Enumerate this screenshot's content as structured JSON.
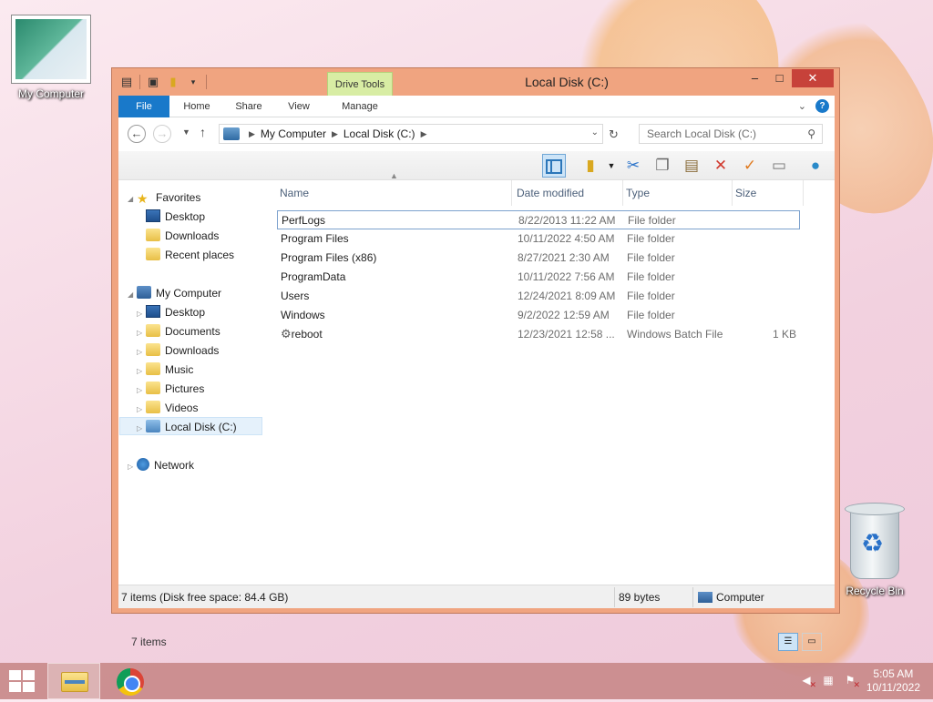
{
  "desktop": {
    "icons": [
      {
        "label": "My Computer"
      },
      {
        "label": "Recycle Bin"
      }
    ]
  },
  "window": {
    "title": "Local Disk (C:)",
    "contextual_tab_group": "Drive Tools",
    "controls": {
      "minimize": "–",
      "maximize": "□",
      "close": "✕"
    },
    "ribbon_tabs": [
      "File",
      "Home",
      "Share",
      "View",
      "Manage"
    ]
  },
  "address_bar": {
    "path": [
      "My Computer",
      "Local Disk (C:)"
    ],
    "search_placeholder": "Search Local Disk (C:)"
  },
  "nav_pane": {
    "favorites_label": "Favorites",
    "favorites": [
      "Desktop",
      "Downloads",
      "Recent places"
    ],
    "computer_label": "My Computer",
    "computer_items": [
      "Desktop",
      "Documents",
      "Downloads",
      "Music",
      "Pictures",
      "Videos",
      "Local Disk (C:)"
    ],
    "network_label": "Network"
  },
  "file_list": {
    "columns": [
      "Name",
      "Date modified",
      "Type",
      "Size"
    ],
    "rows": [
      {
        "name": "PerfLogs",
        "date": "8/22/2013 11:22 AM",
        "type": "File folder",
        "size": "",
        "icon": "folder-icon"
      },
      {
        "name": "Program Files",
        "date": "10/11/2022 4:50 AM",
        "type": "File folder",
        "size": "",
        "icon": "folder-icon"
      },
      {
        "name": "Program Files (x86)",
        "date": "8/27/2021 2:30 AM",
        "type": "File folder",
        "size": "",
        "icon": "folder-icon"
      },
      {
        "name": "ProgramData",
        "date": "10/11/2022 7:56 AM",
        "type": "File folder",
        "size": "",
        "icon": "folder-icon"
      },
      {
        "name": "Users",
        "date": "12/24/2021 8:09 AM",
        "type": "File folder",
        "size": "",
        "icon": "folder-icon"
      },
      {
        "name": "Windows",
        "date": "9/2/2022 12:59 AM",
        "type": "File folder",
        "size": "",
        "icon": "folder-icon"
      },
      {
        "name": "reboot",
        "date": "12/23/2021 12:58 ...",
        "type": "Windows Batch File",
        "size": "1 KB",
        "icon": "batch-file-icon"
      }
    ]
  },
  "footer": {
    "item_count": "7 items"
  },
  "status_bar": {
    "summary": "7 items (Disk free space: 84.4 GB)",
    "size": "89 bytes",
    "location": "Computer"
  },
  "taskbar": {
    "time": "5:05 AM",
    "date": "10/11/2022"
  },
  "colors": {
    "window_frame": "#f0a480",
    "file_tab": "#1979ca",
    "drive_tools": "#d8eda4",
    "taskbar": "#c98a8a"
  }
}
